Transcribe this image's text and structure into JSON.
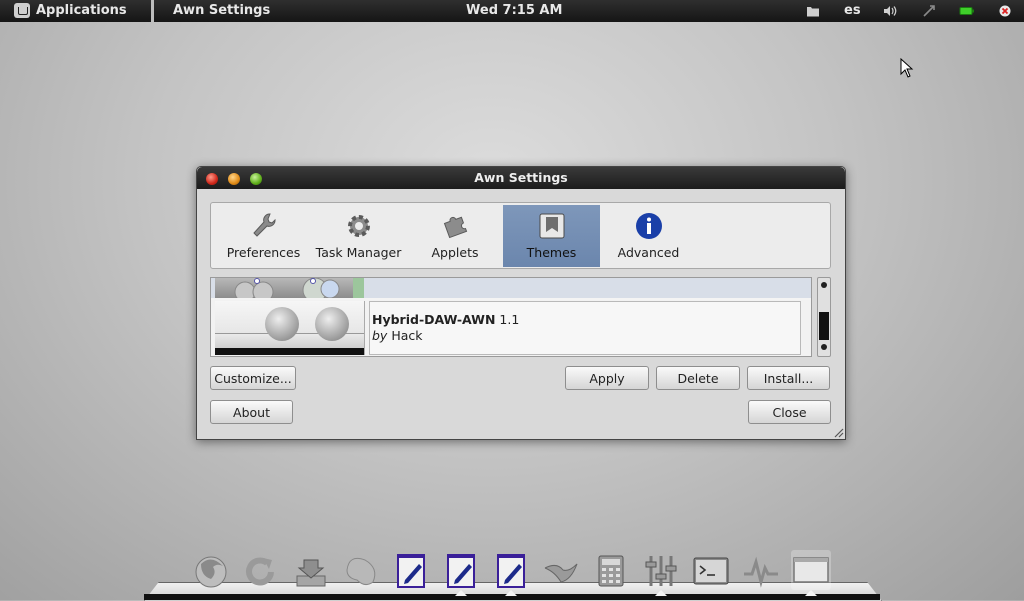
{
  "top_panel": {
    "menu_label": "Applications",
    "active_window_label": "Awn Settings",
    "clock": "Wed  7:15 AM",
    "keyboard_layout": "es",
    "tray_icons": [
      "folder-icon",
      "volume-icon",
      "network-icon",
      "battery-icon",
      "session-quit-icon"
    ]
  },
  "window": {
    "title": "Awn Settings",
    "tabs": [
      {
        "label": "Preferences",
        "icon": "wrench-icon"
      },
      {
        "label": "Task Manager",
        "icon": "gear-icon"
      },
      {
        "label": "Applets",
        "icon": "puzzle-icon"
      },
      {
        "label": "Themes",
        "icon": "themes-book-icon",
        "active": true
      },
      {
        "label": "Advanced",
        "icon": "info-icon"
      }
    ],
    "theme_list": {
      "selected_theme": {
        "name": "Hybrid-DAW-AWN",
        "version": "1.1",
        "by_prefix": "by",
        "author": "Hack"
      }
    },
    "buttons": {
      "customize": "Customize...",
      "apply": "Apply",
      "delete": "Delete",
      "install": "Install...",
      "about": "About",
      "close": "Close"
    }
  },
  "dock": {
    "items": [
      "firefox-icon",
      "refresh-icon",
      "installer-icon",
      "bean-icon",
      "document-editor-icon",
      "document-editor-icon",
      "document-editor-icon",
      "bird-icon",
      "calculator-icon",
      "mixer-icon",
      "terminal-icon",
      "monitor-graph-icon",
      "desktop-icon"
    ],
    "accent_color": "#3a1f99"
  },
  "colors": {
    "selected_tab": "#7e97ba",
    "titlebar": "#2a2a2a",
    "panel": "#1e1e1e"
  }
}
